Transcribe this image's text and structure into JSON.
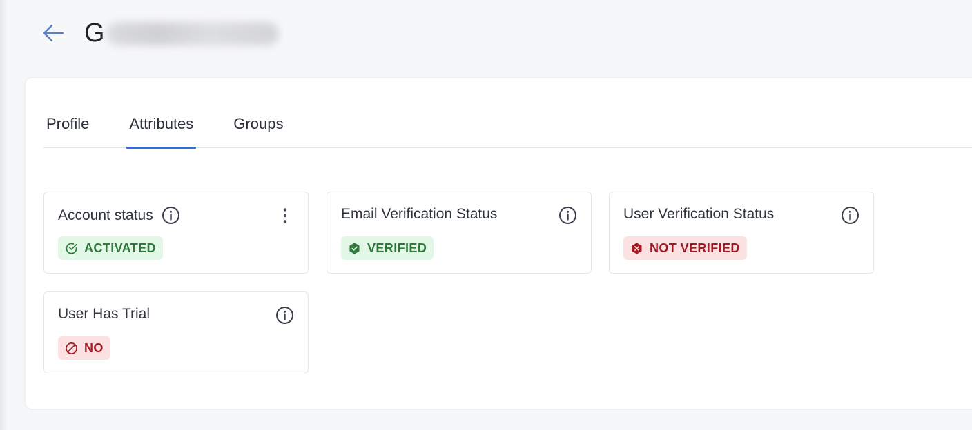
{
  "header": {
    "name_first_letter": "G"
  },
  "tabs": [
    {
      "label": "Profile"
    },
    {
      "label": "Attributes"
    },
    {
      "label": "Groups"
    }
  ],
  "cards": {
    "account_status": {
      "title": "Account status",
      "badge": "ACTIVATED"
    },
    "email_verification": {
      "title": "Email Verification Status",
      "badge": "VERIFIED"
    },
    "user_verification": {
      "title": "User Verification Status",
      "badge": "NOT VERIFIED"
    },
    "user_has_trial": {
      "title": "User Has Trial",
      "badge": "NO"
    }
  },
  "colors": {
    "accent": "#2d6fe0",
    "success_bg": "#e3f7e6",
    "success_text": "#2d7a3a",
    "danger_bg": "#fbe1e2",
    "danger_text": "#a11b22"
  },
  "icons": [
    "back-arrow-icon",
    "info-icon",
    "more-vertical-icon",
    "check-circle-icon",
    "shield-check-icon",
    "shield-x-icon",
    "ban-icon"
  ]
}
